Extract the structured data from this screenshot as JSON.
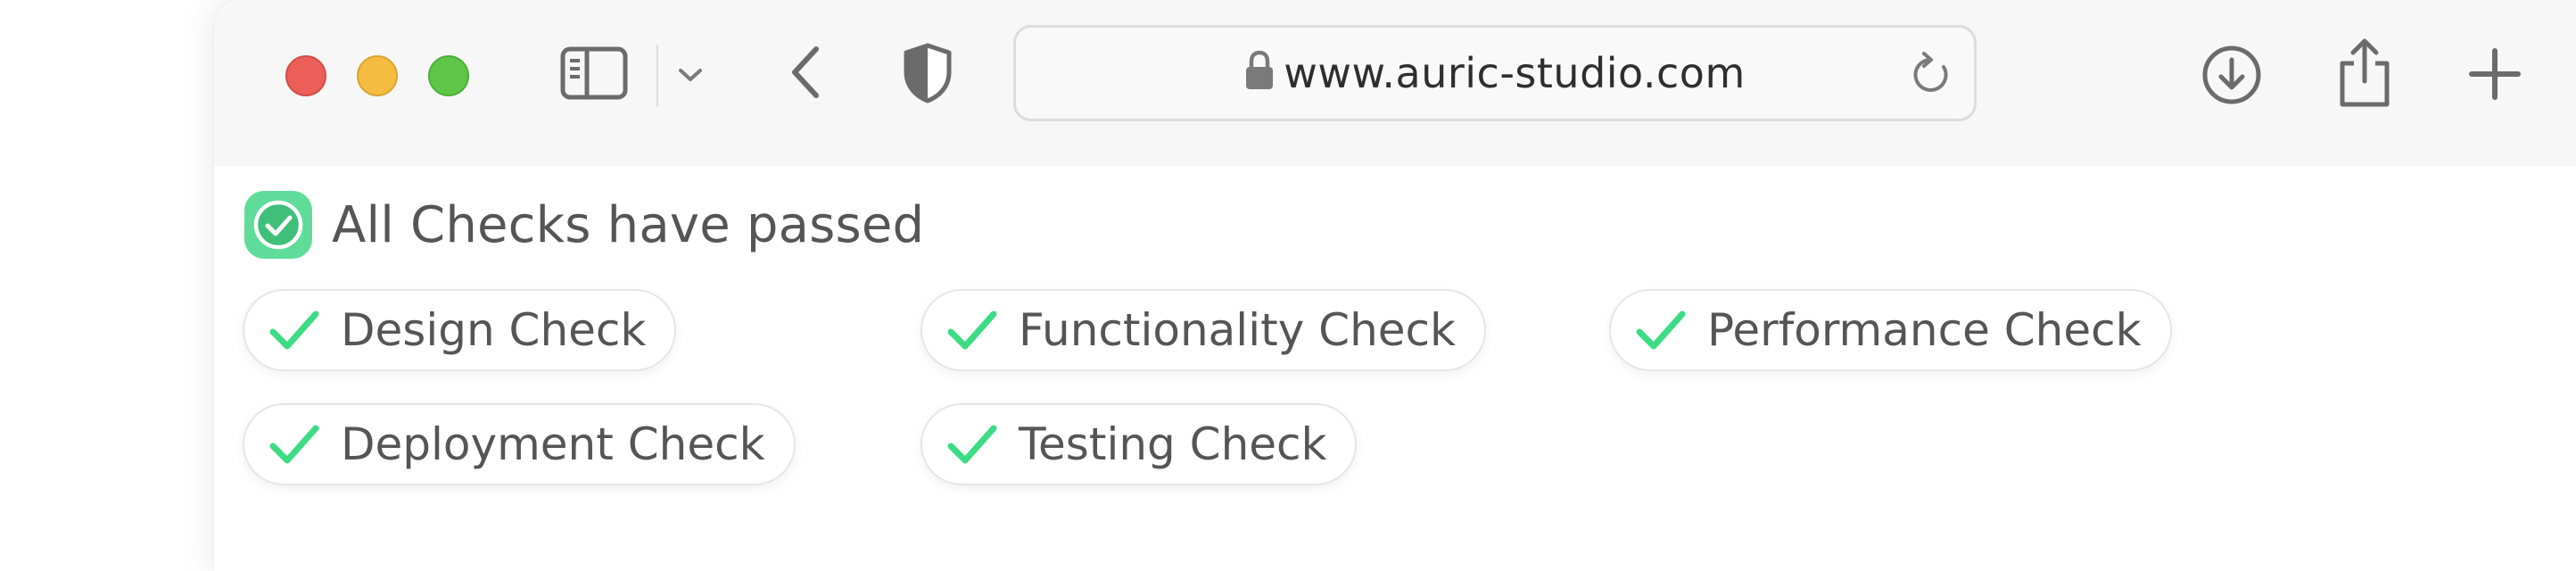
{
  "browser": {
    "url": "www.auric-studio.com",
    "icons": {
      "sidebar": "sidebar-icon",
      "chevron": "chevron-down-icon",
      "back": "back-icon",
      "shield": "shield-icon",
      "lock": "lock-icon",
      "reload": "reload-icon",
      "download": "download-icon",
      "share": "share-icon",
      "new_tab": "plus-icon"
    }
  },
  "checks": {
    "summary": "All Checks have passed",
    "accent_color": "#3ddc84",
    "items": [
      {
        "label": "Design Check"
      },
      {
        "label": "Functionality Check"
      },
      {
        "label": "Performance Check"
      },
      {
        "label": "Deployment Check"
      },
      {
        "label": "Testing Check"
      }
    ]
  }
}
